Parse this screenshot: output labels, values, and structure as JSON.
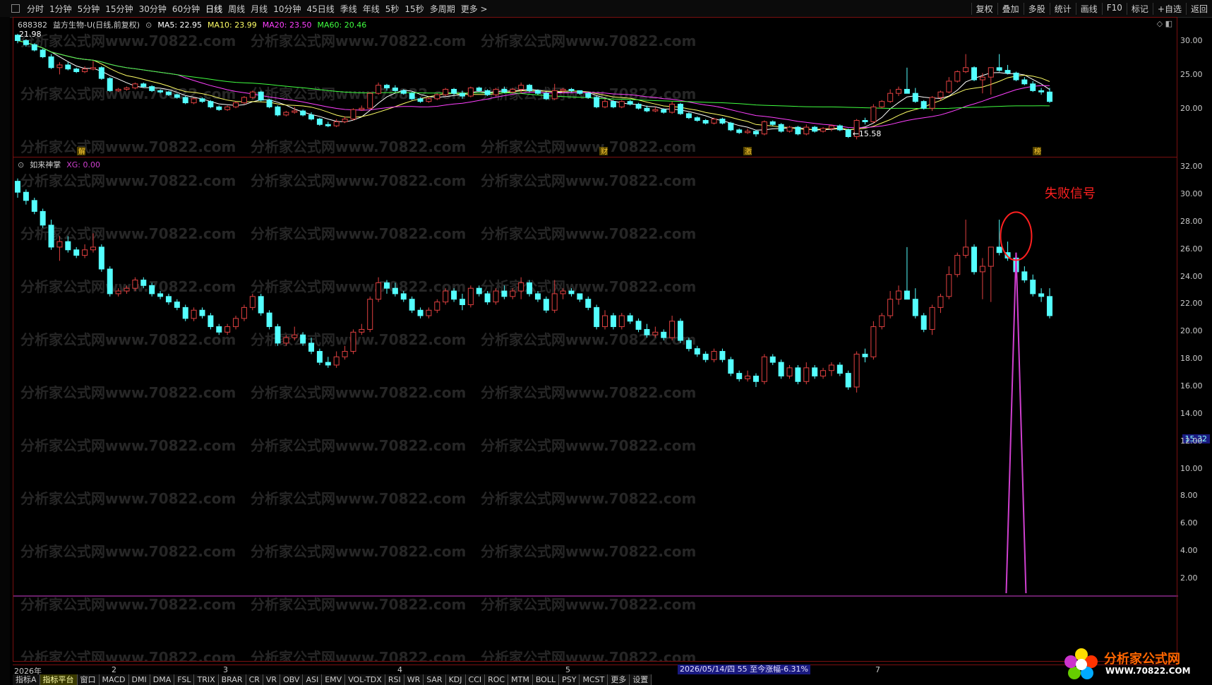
{
  "toolbar": {
    "periods": [
      "分时",
      "1分钟",
      "5分钟",
      "15分钟",
      "30分钟",
      "60分钟",
      "日线",
      "周线",
      "月线",
      "10分钟",
      "45日线",
      "季线",
      "年线",
      "5秒",
      "15秒",
      "多周期",
      "更多 >"
    ],
    "active": "日线",
    "right_buttons": [
      "复权",
      "叠加",
      "多股",
      "统计",
      "画线",
      "F10",
      "标记",
      "+自选",
      "返回"
    ]
  },
  "main_panel": {
    "code": "688382",
    "name": "益方生物-U(日线,前复权)",
    "ma5": "MA5: 22.95",
    "ma10": "MA10: 23.99",
    "ma20": "MA20: 23.50",
    "ma60": "MA60: 20.46",
    "high_label": "21.98",
    "low_label": "←15.58",
    "markers": [
      "解",
      "财",
      "激",
      "榜"
    ],
    "axis_labels": [
      "30.00",
      "25.00",
      "20.00"
    ],
    "colors": {
      "up": "#e04040",
      "down": "#54ffff",
      "ma5": "#ffffff",
      "ma10": "#ffff66",
      "ma20": "#ff40ff",
      "ma60": "#40ff40"
    }
  },
  "indicator_panel": {
    "name": "如来神掌",
    "xg_label": "XG: 0.00",
    "axis_labels": [
      "32.00",
      "30.00",
      "28.00",
      "26.00",
      "24.00",
      "22.00",
      "20.00",
      "18.00",
      "16.00",
      "14.00",
      "12.00",
      "10.00",
      "8.00",
      "6.00",
      "4.00",
      "2.00"
    ],
    "price_tag": "15.32",
    "annotation": "失败信号",
    "signal_color": "#d040d0"
  },
  "date_axis": {
    "labels": [
      "2026年",
      "2",
      "3",
      "4",
      "5",
      "7"
    ],
    "stat": "2026/05/14/四 55 至今涨幅-6.31%"
  },
  "tabs": [
    "指标A",
    "指标平台",
    "窗口",
    "MACD",
    "DMI",
    "DMA",
    "FSL",
    "TRIX",
    "BRAR",
    "CR",
    "VR",
    "OBV",
    "ASI",
    "EMV",
    "VOL-TDX",
    "RSI",
    "WR",
    "SAR",
    "KDJ",
    "CCI",
    "ROC",
    "MTM",
    "BOLL",
    "PSY",
    "MCST",
    "更多",
    "设置"
  ],
  "watermark": "分析家公式网www.70822.com",
  "logo": {
    "title": "分析家公式网",
    "url": "WWW.70822.COM"
  },
  "chart_data": [
    {
      "type": "candlestick",
      "title": "688382 益方生物-U(日线,前复权)",
      "ylim": [
        14,
        32
      ],
      "candles_ohlc": [
        [
          31.0,
          31.2,
          29.8,
          30.2
        ],
        [
          30.2,
          30.4,
          29.3,
          29.6
        ],
        [
          29.6,
          29.8,
          28.6,
          28.8
        ],
        [
          28.8,
          29.0,
          27.6,
          27.8
        ],
        [
          27.8,
          28.2,
          26.0,
          26.2
        ],
        [
          26.2,
          27.0,
          25.2,
          26.6
        ],
        [
          26.6,
          27.0,
          25.8,
          26.0
        ],
        [
          26.0,
          26.2,
          25.4,
          25.6
        ],
        [
          25.6,
          26.4,
          25.4,
          26.0
        ],
        [
          26.0,
          27.2,
          25.8,
          26.2
        ],
        [
          26.2,
          26.4,
          24.4,
          24.6
        ],
        [
          24.6,
          24.8,
          22.6,
          22.8
        ],
        [
          22.8,
          23.2,
          22.6,
          23.0
        ],
        [
          23.0,
          23.4,
          22.8,
          23.2
        ],
        [
          23.2,
          24.0,
          23.0,
          23.8
        ],
        [
          23.8,
          24.0,
          23.2,
          23.4
        ],
        [
          23.4,
          23.6,
          22.6,
          22.8
        ],
        [
          22.8,
          23.0,
          22.4,
          22.6
        ],
        [
          22.6,
          22.8,
          22.0,
          22.2
        ],
        [
          22.2,
          22.4,
          21.6,
          21.8
        ],
        [
          21.8,
          22.0,
          20.8,
          21.0
        ],
        [
          21.0,
          21.8,
          20.8,
          21.6
        ],
        [
          21.6,
          21.8,
          21.0,
          21.2
        ],
        [
          21.2,
          21.4,
          20.2,
          20.4
        ],
        [
          20.4,
          20.6,
          19.8,
          20.0
        ],
        [
          20.0,
          20.6,
          19.8,
          20.4
        ],
        [
          20.4,
          21.2,
          20.2,
          21.0
        ],
        [
          21.0,
          22.0,
          20.8,
          21.8
        ],
        [
          21.8,
          22.8,
          21.6,
          22.6
        ],
        [
          22.6,
          22.8,
          21.2,
          21.4
        ],
        [
          21.4,
          21.6,
          20.2,
          20.4
        ],
        [
          20.4,
          20.6,
          19.0,
          19.2
        ],
        [
          19.2,
          19.8,
          19.0,
          19.6
        ],
        [
          19.6,
          20.4,
          19.4,
          19.8
        ],
        [
          19.8,
          20.0,
          19.0,
          19.2
        ],
        [
          19.2,
          19.6,
          18.4,
          18.6
        ],
        [
          18.6,
          18.8,
          17.6,
          17.8
        ],
        [
          17.8,
          18.2,
          17.4,
          17.6
        ],
        [
          17.6,
          18.6,
          17.4,
          18.2
        ],
        [
          18.2,
          19.0,
          18.0,
          18.6
        ],
        [
          18.6,
          20.2,
          18.4,
          20.0
        ],
        [
          20.0,
          20.6,
          19.8,
          20.2
        ],
        [
          20.2,
          22.6,
          20.0,
          22.4
        ],
        [
          22.4,
          24.0,
          22.2,
          23.6
        ],
        [
          23.6,
          23.8,
          22.8,
          23.2
        ],
        [
          23.2,
          23.6,
          22.6,
          22.8
        ],
        [
          22.8,
          23.0,
          22.2,
          22.4
        ],
        [
          22.4,
          22.6,
          21.4,
          21.6
        ],
        [
          21.6,
          21.8,
          21.0,
          21.2
        ],
        [
          21.2,
          21.8,
          21.0,
          21.6
        ],
        [
          21.6,
          22.4,
          21.4,
          22.2
        ],
        [
          22.2,
          23.2,
          22.0,
          23.0
        ],
        [
          23.0,
          23.2,
          22.2,
          22.4
        ],
        [
          22.4,
          22.8,
          21.6,
          22.0
        ],
        [
          22.0,
          23.4,
          21.8,
          23.2
        ],
        [
          23.2,
          23.4,
          22.6,
          22.8
        ],
        [
          22.8,
          23.0,
          22.0,
          22.2
        ],
        [
          22.2,
          23.2,
          22.0,
          23.0
        ],
        [
          23.0,
          23.4,
          22.4,
          22.6
        ],
        [
          22.6,
          23.2,
          22.4,
          23.0
        ],
        [
          23.0,
          24.0,
          22.4,
          23.6
        ],
        [
          23.6,
          23.8,
          22.6,
          22.8
        ],
        [
          22.8,
          23.0,
          22.2,
          22.4
        ],
        [
          22.4,
          22.6,
          21.4,
          21.6
        ],
        [
          21.6,
          23.8,
          21.4,
          22.8
        ],
        [
          22.8,
          23.2,
          22.4,
          23.0
        ],
        [
          23.0,
          23.2,
          22.6,
          22.8
        ],
        [
          22.8,
          22.8,
          22.2,
          22.4
        ],
        [
          22.4,
          22.6,
          21.6,
          21.8
        ],
        [
          21.8,
          22.0,
          20.2,
          20.4
        ],
        [
          20.4,
          21.6,
          20.2,
          21.2
        ],
        [
          21.2,
          21.4,
          20.2,
          20.4
        ],
        [
          20.4,
          21.4,
          20.2,
          21.2
        ],
        [
          21.2,
          21.4,
          20.6,
          20.8
        ],
        [
          20.8,
          21.0,
          20.0,
          20.2
        ],
        [
          20.2,
          20.6,
          19.6,
          19.8
        ],
        [
          19.8,
          20.4,
          19.6,
          20.0
        ],
        [
          20.0,
          20.2,
          19.4,
          19.6
        ],
        [
          19.6,
          21.2,
          19.4,
          20.8
        ],
        [
          20.8,
          21.0,
          19.2,
          19.4
        ],
        [
          19.4,
          19.6,
          18.6,
          18.8
        ],
        [
          18.8,
          19.0,
          18.2,
          18.4
        ],
        [
          18.4,
          18.6,
          17.8,
          18.0
        ],
        [
          18.0,
          18.8,
          17.8,
          18.6
        ],
        [
          18.6,
          18.8,
          17.8,
          18.0
        ],
        [
          18.0,
          18.2,
          16.8,
          17.0
        ],
        [
          17.0,
          17.2,
          16.4,
          16.6
        ],
        [
          16.6,
          17.2,
          16.4,
          16.8
        ],
        [
          16.8,
          17.0,
          16.0,
          16.4
        ],
        [
          16.4,
          18.4,
          16.2,
          18.2
        ],
        [
          18.2,
          18.4,
          17.6,
          17.8
        ],
        [
          17.8,
          18.0,
          16.6,
          16.8
        ],
        [
          16.8,
          17.6,
          16.6,
          17.4
        ],
        [
          17.4,
          17.6,
          16.2,
          16.4
        ],
        [
          16.4,
          17.8,
          16.2,
          17.4
        ],
        [
          17.4,
          17.6,
          16.6,
          16.8
        ],
        [
          16.8,
          17.4,
          16.6,
          17.2
        ],
        [
          17.2,
          17.8,
          16.8,
          17.6
        ],
        [
          17.6,
          17.8,
          16.8,
          17.0
        ],
        [
          17.0,
          17.2,
          15.8,
          16.0
        ],
        [
          16.0,
          18.6,
          15.6,
          18.4
        ],
        [
          18.4,
          18.8,
          17.8,
          18.2
        ],
        [
          18.2,
          20.8,
          18.0,
          20.4
        ],
        [
          20.4,
          21.4,
          20.2,
          21.2
        ],
        [
          21.2,
          23.0,
          21.0,
          22.4
        ],
        [
          22.4,
          23.4,
          22.0,
          23.0
        ],
        [
          23.0,
          26.2,
          22.6,
          22.4
        ],
        [
          22.4,
          23.2,
          21.0,
          21.2
        ],
        [
          21.2,
          21.4,
          20.0,
          20.2
        ],
        [
          20.2,
          22.0,
          19.8,
          21.8
        ],
        [
          21.8,
          22.8,
          21.4,
          22.6
        ],
        [
          22.6,
          24.8,
          22.4,
          24.2
        ],
        [
          24.2,
          25.8,
          24.0,
          25.6
        ],
        [
          25.6,
          28.2,
          25.4,
          26.2
        ],
        [
          26.2,
          26.4,
          24.2,
          24.4
        ],
        [
          24.4,
          25.4,
          22.4,
          24.8
        ],
        [
          24.8,
          26.2,
          22.2,
          26.2
        ],
        [
          26.2,
          28.2,
          25.6,
          25.8
        ],
        [
          25.8,
          26.6,
          25.2,
          25.4
        ],
        [
          25.4,
          25.6,
          24.2,
          24.4
        ],
        [
          24.4,
          24.8,
          23.6,
          23.8
        ],
        [
          23.8,
          24.2,
          22.6,
          22.8
        ],
        [
          22.8,
          23.2,
          22.2,
          22.6
        ],
        [
          22.6,
          23.2,
          21.0,
          21.2
        ]
      ],
      "extremes": {
        "high": 21.98,
        "low": 15.58
      }
    },
    {
      "type": "line",
      "title": "如来神掌",
      "ylim": [
        0,
        32
      ],
      "series": [
        {
          "name": "XG",
          "values": [
            0.0
          ]
        }
      ],
      "signal_candle_index": 119
    }
  ]
}
